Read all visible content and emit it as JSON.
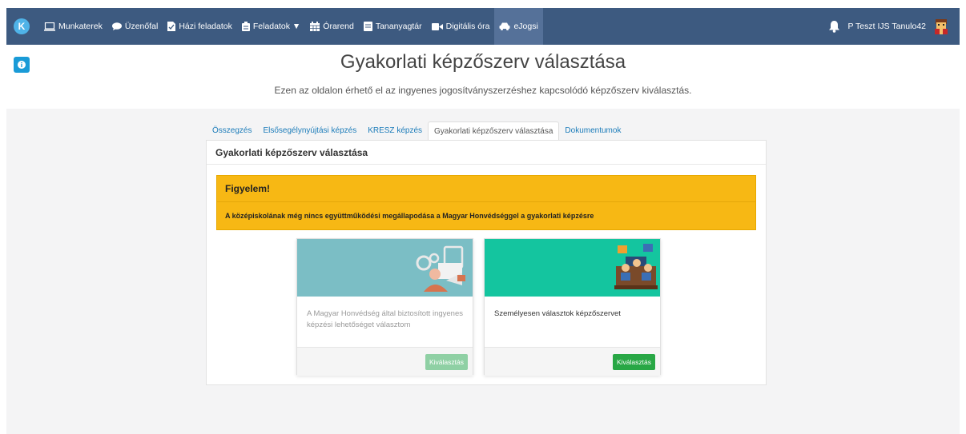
{
  "nav": {
    "items": [
      {
        "label": "Munkaterek",
        "icon": "laptop-icon"
      },
      {
        "label": "Üzenőfal",
        "icon": "chat-icon"
      },
      {
        "label": "Házi feladatok",
        "icon": "homework-icon"
      },
      {
        "label": "Feladatok ▼",
        "icon": "task-icon"
      },
      {
        "label": "Órarend",
        "icon": "calendar-icon"
      },
      {
        "label": "Tananyagtár",
        "icon": "book-icon"
      },
      {
        "label": "Digitális óra",
        "icon": "video-icon"
      },
      {
        "label": "eJogsi",
        "icon": "car-icon"
      }
    ],
    "user_name": "P Teszt IJS Tanulo42"
  },
  "header": {
    "title": "Gyakorlati képzőszerv választása",
    "subtitle": "Ezen az oldalon érhető el az ingyenes jogosítványszerzéshez kapcsolódó képzőszerv kiválasztás."
  },
  "tabs": [
    {
      "label": "Összegzés"
    },
    {
      "label": "Elsősegélynyújtási képzés"
    },
    {
      "label": "KRESZ képzés"
    },
    {
      "label": "Gyakorlati képzőszerv választása"
    },
    {
      "label": "Dokumentumok"
    }
  ],
  "panel": {
    "title": "Gyakorlati képzőszerv választása",
    "alert": {
      "title": "Figyelem!",
      "message": "A középiskolának még nincs együttműködési megállapodása a Magyar Honvédséggel a gyakorlati képzésre"
    },
    "cards": [
      {
        "text": "A Magyar Honvédség által biztosított ingyenes képzési lehetőséget választom",
        "button": "Kiválasztás",
        "enabled": false
      },
      {
        "text": "Személyesen választok képzőszervet",
        "button": "Kiválasztás",
        "enabled": true
      }
    ]
  },
  "colors": {
    "navbar": "#3d5a80",
    "alert": "#f7b814",
    "button": "#28a745",
    "link": "#1a7bb9"
  }
}
